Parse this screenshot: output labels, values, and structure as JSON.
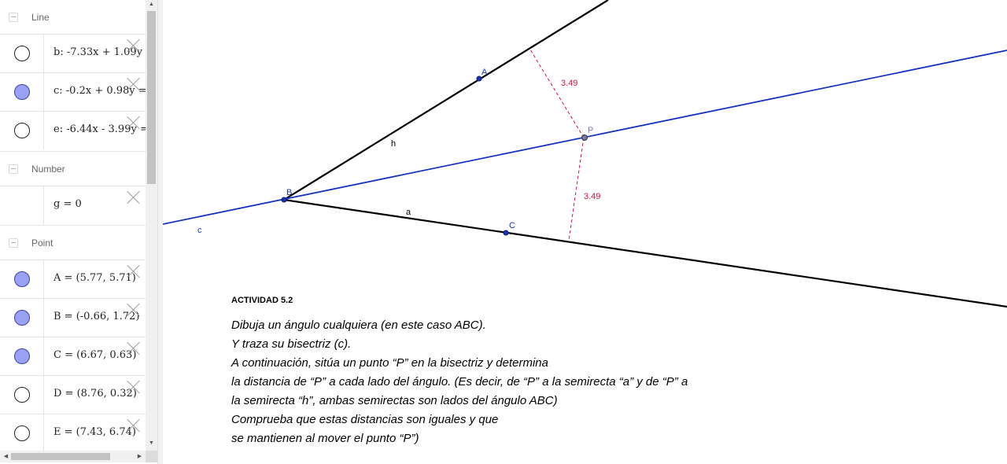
{
  "algebra": {
    "groups": [
      {
        "label": "Line",
        "items": [
          {
            "expr": "b: -7.33x + 1.09y = ",
            "visible": false
          },
          {
            "expr": "c: -0.2x + 0.98y = ",
            "visible": true
          },
          {
            "expr": "e: -6.44x - 3.99y = -",
            "visible": false
          }
        ]
      },
      {
        "label": "Number",
        "items": [
          {
            "expr": "g = 0",
            "visible": null
          }
        ]
      },
      {
        "label": "Point",
        "items": [
          {
            "expr": "A = (5.77, 5.71)",
            "visible": true
          },
          {
            "expr": "B = (-0.66, 1.72)",
            "visible": true
          },
          {
            "expr": "C = (6.67, 0.63)",
            "visible": true
          },
          {
            "expr": "D = (8.76, 0.32)",
            "visible": false
          },
          {
            "expr": "E = (7.43, 6.74)",
            "visible": false
          }
        ]
      }
    ]
  },
  "graphics": {
    "labels": {
      "A": "A",
      "B": "B",
      "C": "C",
      "P": "P",
      "h": "h",
      "a": "a",
      "c": "c",
      "dist1": "3.49",
      "dist2": "3.49"
    },
    "colors": {
      "sides": "#000000",
      "bisector": "#1533c0",
      "point": "#1533c0",
      "distance": "#d0143c"
    }
  },
  "activity": {
    "title": "ACTIVIDAD 5.2",
    "lines": [
      "Dibuja un ángulo cualquiera (en este caso ABC).",
      "Y traza su bisectriz (c).",
      "A continuación, sitúa un punto “P” en la bisectriz y determina",
      "la distancia de “P” a cada lado del ángulo. (Es decir, de “P” a la semirecta “a” y de “P” a",
      "la semirecta “h”, ambas semirectas son lados del ángulo ABC)",
      "Comprueba que estas distancias son iguales y que",
      "se mantienen al mover el punto “P”)"
    ]
  }
}
